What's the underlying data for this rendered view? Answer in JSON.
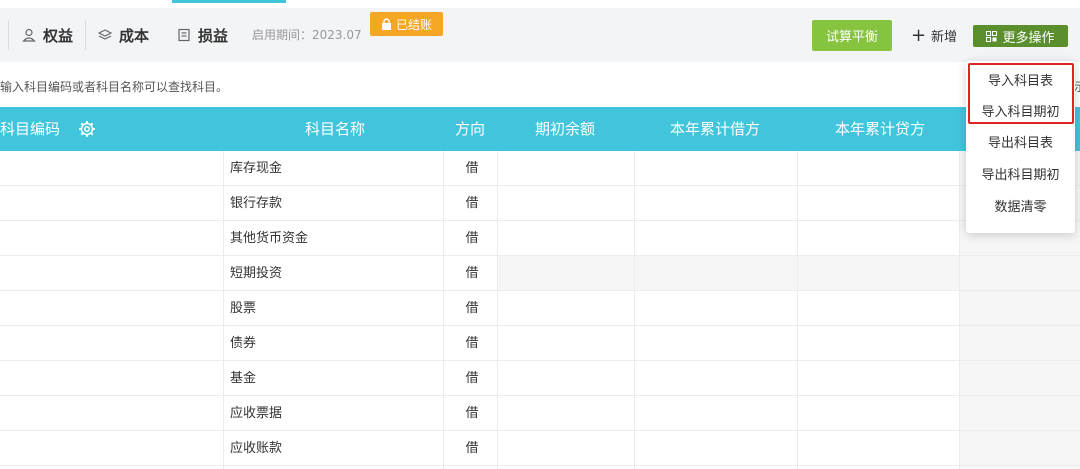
{
  "toolbar": {
    "tabs": [
      {
        "label": "权益",
        "icon": "person-icon"
      },
      {
        "label": "成本",
        "icon": "layers-icon"
      },
      {
        "label": "损益",
        "icon": "document-icon"
      }
    ],
    "period_text": "启用期间：2023.07",
    "lock_badge": "已结账",
    "trial_balance_label": "试算平衡",
    "add_label": "新增",
    "more_label": "更多操作"
  },
  "hint": {
    "text": "请输入科目编码或者科目名称可以查找科目。",
    "right_fragment": "示"
  },
  "table": {
    "headers": [
      "科目编码",
      "科目名称",
      "方向",
      "期初余额",
      "本年累计借方",
      "本年累计贷方"
    ],
    "rows": [
      {
        "name": "库存现金",
        "direction": "借"
      },
      {
        "name": "银行存款",
        "direction": "借"
      },
      {
        "name": "其他货币资金",
        "direction": "借"
      },
      {
        "name": "短期投资",
        "direction": "借"
      },
      {
        "name": "股票",
        "direction": "借"
      },
      {
        "name": "债券",
        "direction": "借"
      },
      {
        "name": "基金",
        "direction": "借"
      },
      {
        "name": "应收票据",
        "direction": "借"
      },
      {
        "name": "应收账款",
        "direction": "借"
      }
    ]
  },
  "dropdown": {
    "items": [
      "导入科目表",
      "导入科目期初",
      "导出科目表",
      "导出科目期初",
      "数据清零"
    ]
  },
  "colors": {
    "header_bg": "#40c5dd",
    "trial_button": "#86c440",
    "more_button": "#5b8e2d",
    "lock_badge": "#f5a623",
    "highlight": "#e02424"
  }
}
